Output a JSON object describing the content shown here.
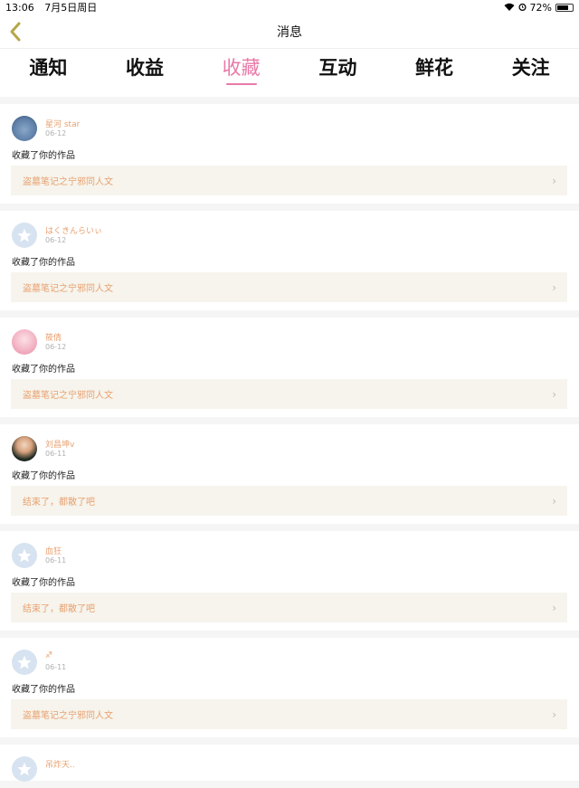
{
  "status": {
    "time": "13:06",
    "date": "7月5日周日",
    "battery": "72%",
    "battery_level": 0.72
  },
  "header": {
    "title": "消息"
  },
  "tabs": [
    {
      "label": "通知",
      "active": false
    },
    {
      "label": "收益",
      "active": false
    },
    {
      "label": "收藏",
      "active": true
    },
    {
      "label": "互动",
      "active": false
    },
    {
      "label": "鲜花",
      "active": false
    },
    {
      "label": "关注",
      "active": false
    }
  ],
  "items": [
    {
      "username": "星河 star",
      "date": "06-12",
      "action": "收藏了你的作品",
      "work": "盗墓笔记之宁邪同人文"
    },
    {
      "username": "はくきんらいぃ",
      "date": "06-12",
      "action": "收藏了你的作品",
      "work": "盗墓笔记之宁邪同人文"
    },
    {
      "username": "筱倩",
      "date": "06-12",
      "action": "收藏了你的作品",
      "work": "盗墓笔记之宁邪同人文"
    },
    {
      "username": "刘昌坤v",
      "date": "06-11",
      "action": "收藏了你的作品",
      "work": "结束了，都散了吧"
    },
    {
      "username": "血狂",
      "date": "06-11",
      "action": "收藏了你的作品",
      "work": "结束了，都散了吧"
    },
    {
      "username": "♐",
      "date": "06-11",
      "action": "收藏了你的作品",
      "work": "盗墓笔记之宁邪同人文"
    },
    {
      "username": "吊炸天..",
      "date": "",
      "action": "",
      "work": ""
    }
  ]
}
